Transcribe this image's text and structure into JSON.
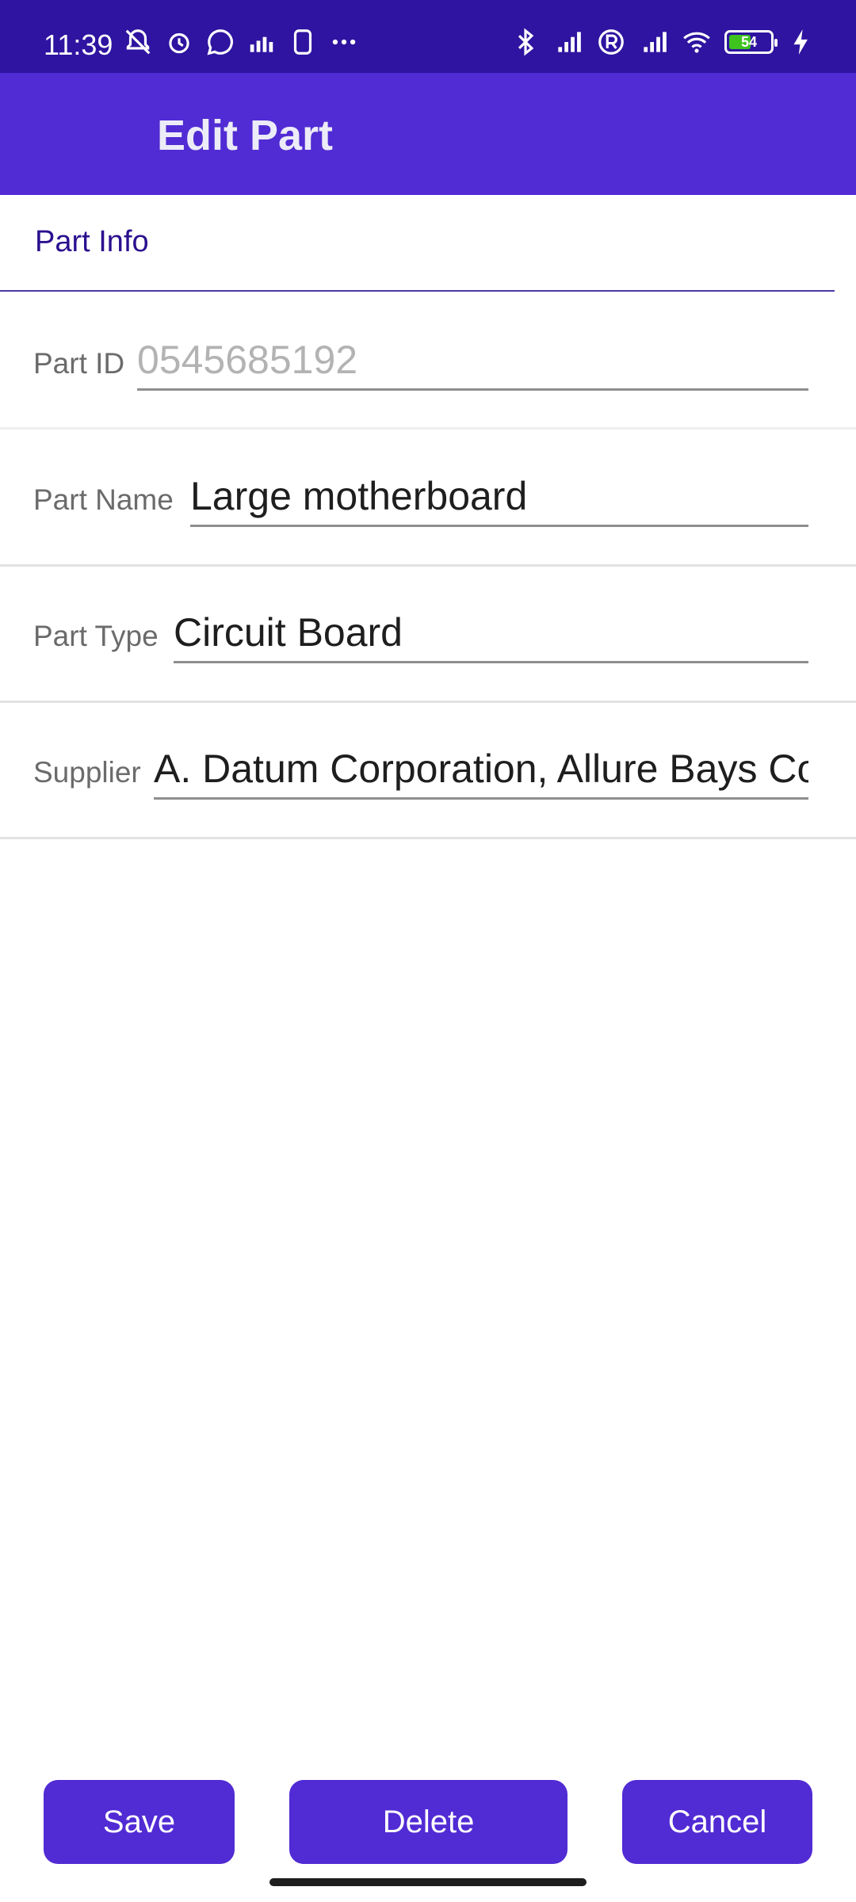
{
  "status_bar": {
    "time": "11:39",
    "battery_level": "54",
    "battery_fraction": 0.54,
    "icons_left": [
      "muted-alarm-icon",
      "alarm-icon",
      "whatsapp-icon",
      "equalizer-icon",
      "sim-icon",
      "more-dots-icon"
    ],
    "icons_right": [
      "bluetooth-icon",
      "signal-4g-icon",
      "registered-icon",
      "signal-icon",
      "wifi-icon",
      "battery-icon",
      "charging-icon"
    ]
  },
  "app_bar": {
    "title": "Edit Part"
  },
  "section": {
    "title": "Part Info"
  },
  "fields": [
    {
      "label": "Part ID",
      "value": "",
      "placeholder": "0545685192"
    },
    {
      "label": "Part Name",
      "value": "Large motherboard",
      "placeholder": ""
    },
    {
      "label": "Part Type",
      "value": "Circuit Board",
      "placeholder": ""
    },
    {
      "label": "Supplier",
      "value": "A. Datum Corporation, Allure Bays Co",
      "placeholder": ""
    }
  ],
  "buttons": {
    "save": "Save",
    "delete": "Delete",
    "cancel": "Cancel"
  },
  "colors": {
    "primary": "#512bd4",
    "status_bar": "#2e14a0",
    "section_text": "#2b108f"
  }
}
